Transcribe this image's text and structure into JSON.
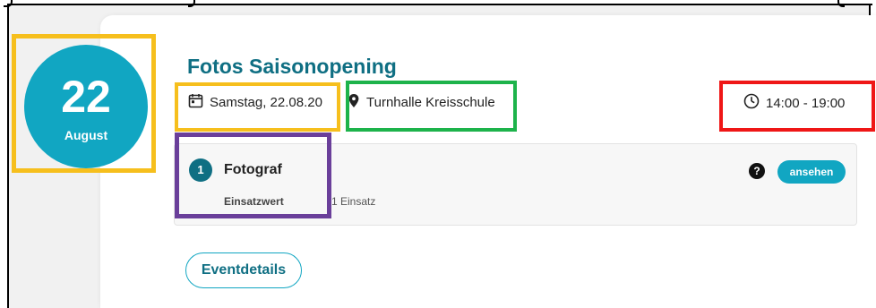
{
  "event": {
    "day": "22",
    "month": "August",
    "title": "Fotos Saisonopening",
    "date": "Samstag, 22.08.20",
    "location": "Turnhalle Kreisschule",
    "time": "14:00 - 19:00"
  },
  "task": {
    "number": "1",
    "title": "Fotograf",
    "value_label": "Einsatzwert",
    "value": "1 Einsatz",
    "help_label": "?",
    "view_label": "ansehen"
  },
  "actions": {
    "details_label": "Eventdetails"
  },
  "colors": {
    "accent": "#11a6c2",
    "title": "#0f6f83",
    "highlight_yellow": "#f6bf1d",
    "highlight_green": "#1db34b",
    "highlight_red": "#ef1717",
    "highlight_purple": "#6a3f9a"
  },
  "icons": {
    "date": "calendar-icon",
    "location": "location-pin-icon",
    "time": "clock-icon",
    "help": "question-icon"
  }
}
